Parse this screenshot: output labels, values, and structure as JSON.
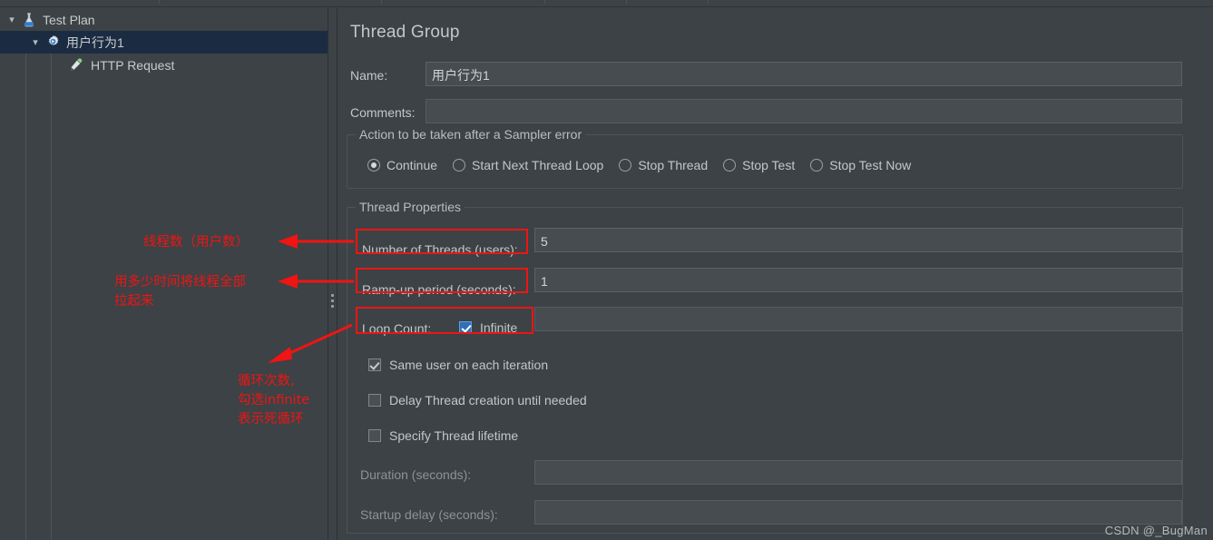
{
  "tree": {
    "items": [
      {
        "label": "Test Plan",
        "icon": "flask-icon",
        "depth": 0,
        "selected": false,
        "expanded": true
      },
      {
        "label": "用户行为1",
        "icon": "gear-icon",
        "depth": 1,
        "selected": true,
        "expanded": true
      },
      {
        "label": "HTTP Request",
        "icon": "pipette-icon",
        "depth": 2,
        "selected": false,
        "expanded": false
      }
    ]
  },
  "panel": {
    "title": "Thread Group",
    "name_label": "Name:",
    "name_value": "用户行为1",
    "comments_label": "Comments:",
    "comments_value": ""
  },
  "sampler_error": {
    "legend": "Action to be taken after a Sampler error",
    "options": [
      {
        "label": "Continue",
        "selected": true
      },
      {
        "label": "Start Next Thread Loop",
        "selected": false
      },
      {
        "label": "Stop Thread",
        "selected": false
      },
      {
        "label": "Stop Test",
        "selected": false
      },
      {
        "label": "Stop Test Now",
        "selected": false
      }
    ]
  },
  "thread_properties": {
    "legend": "Thread Properties",
    "num_threads_label": "Number of Threads (users):",
    "num_threads_value": "5",
    "rampup_label": "Ramp-up period (seconds):",
    "rampup_value": "1",
    "loop_count_label": "Loop Count:",
    "loop_count_value": "",
    "infinite_label": "Infinite",
    "infinite_checked": true,
    "checkboxes": [
      {
        "label": "Same user on each iteration",
        "checked": true,
        "enabled": true
      },
      {
        "label": "Delay Thread creation until needed",
        "checked": false,
        "enabled": true
      },
      {
        "label": "Specify Thread lifetime",
        "checked": false,
        "enabled": true
      }
    ],
    "duration_label": "Duration (seconds):",
    "duration_value": "",
    "startup_delay_label": "Startup delay (seconds):",
    "startup_delay_value": ""
  },
  "annotations": {
    "accent_color": "#f01414",
    "note_threads": "线程数（用户数）",
    "note_rampup": "用多少时间将线程全部\n拉起来",
    "note_loop": "循环次数,\n勾选infinite\n表示死循环"
  },
  "watermark": "CSDN @_BugMan"
}
